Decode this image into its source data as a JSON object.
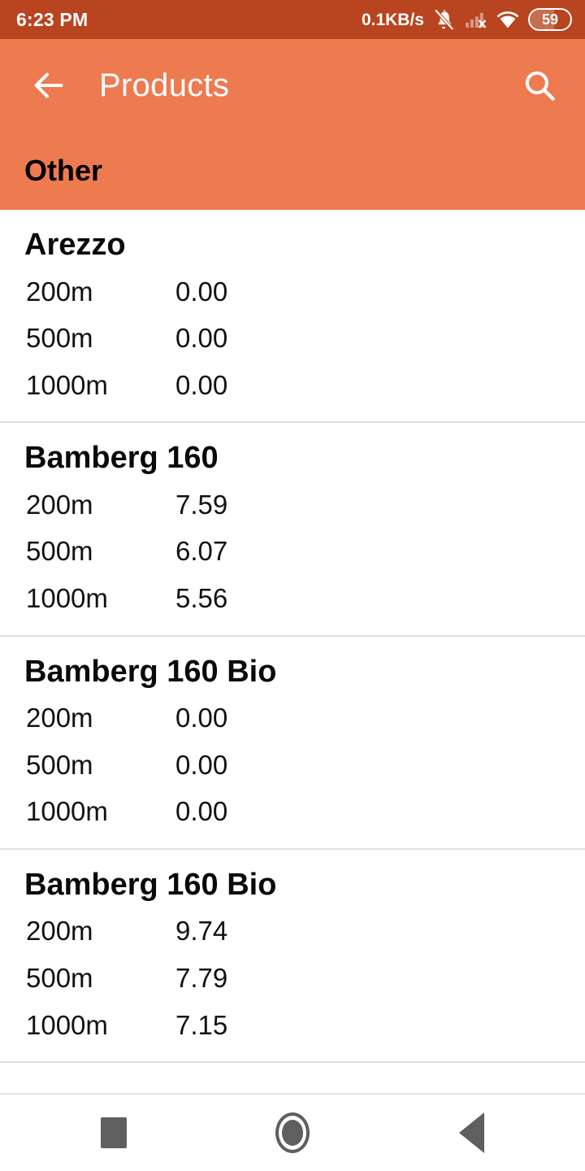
{
  "status_bar": {
    "time": "6:23 PM",
    "network_speed": "0.1KB/s",
    "icons": [
      "bell-muted-icon",
      "signal-no-sim-icon",
      "wifi-icon"
    ],
    "battery_level": "59",
    "background_color": "#b8451f"
  },
  "app_bar": {
    "back_label": "back-arrow",
    "title": "Products",
    "search_label": "search",
    "background_color": "#ee7a50",
    "title_color": "#ffffff"
  },
  "category": {
    "title": "Other",
    "background_color": "#ee7a50",
    "text_color": "#000000"
  },
  "product_groups": [
    {
      "name": "Arezzo",
      "rows": [
        {
          "label": "200m",
          "value": "0.00"
        },
        {
          "label": "500m",
          "value": "0.00"
        },
        {
          "label": "1000m",
          "value": "0.00"
        }
      ]
    },
    {
      "name": "Bamberg 160",
      "rows": [
        {
          "label": "200m",
          "value": "7.59"
        },
        {
          "label": "500m",
          "value": "6.07"
        },
        {
          "label": "1000m",
          "value": "5.56"
        }
      ]
    },
    {
      "name": "Bamberg 160 Bio",
      "rows": [
        {
          "label": "200m",
          "value": "0.00"
        },
        {
          "label": "500m",
          "value": "0.00"
        },
        {
          "label": "1000m",
          "value": "0.00"
        }
      ]
    },
    {
      "name": "Bamberg 160 Bio",
      "rows": [
        {
          "label": "200m",
          "value": "9.74"
        },
        {
          "label": "500m",
          "value": "7.79"
        },
        {
          "label": "1000m",
          "value": "7.15"
        }
      ]
    }
  ],
  "nav_bar": {
    "recents_label": "recents",
    "home_label": "home",
    "back_label": "back",
    "icon_color": "#5f5f5f"
  }
}
